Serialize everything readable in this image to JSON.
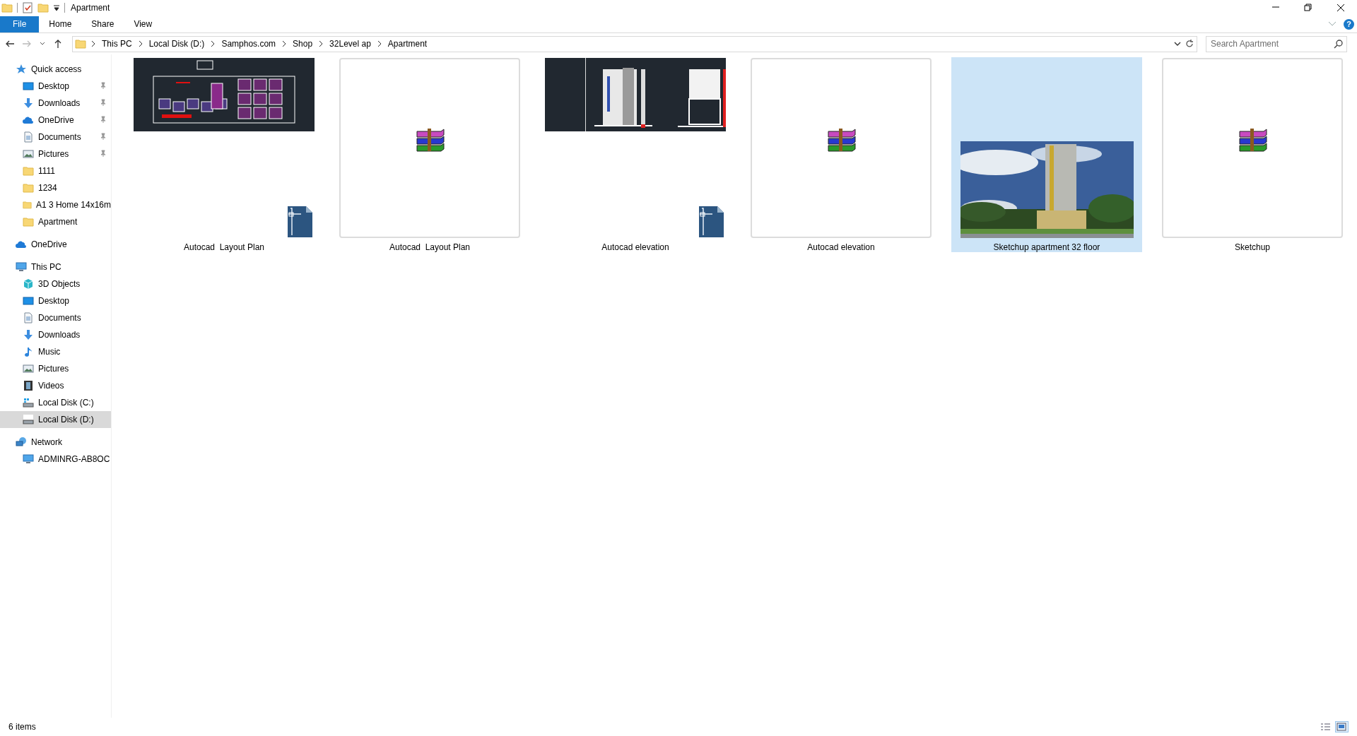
{
  "window": {
    "title": "Apartment"
  },
  "ribbon_tabs": [
    {
      "label": "File",
      "kind": "file"
    },
    {
      "label": "Home",
      "kind": "tab"
    },
    {
      "label": "Share",
      "kind": "tab"
    },
    {
      "label": "View",
      "kind": "tab"
    }
  ],
  "help": "?",
  "address_bar": {
    "path": [
      "This PC",
      "Local Disk (D:)",
      "Samphos.com",
      "Shop",
      "32Level ap",
      "Apartment"
    ]
  },
  "search": {
    "placeholder": "Search Apartment"
  },
  "sidebar": {
    "items": [
      {
        "label": "Quick access",
        "kind": "star",
        "selected": false,
        "children": [
          {
            "label": "Desktop",
            "kind": "desktop",
            "pinned": true,
            "selected": false
          },
          {
            "label": "Downloads",
            "kind": "download",
            "pinned": true,
            "selected": false
          },
          {
            "label": "OneDrive",
            "kind": "cloud",
            "pinned": true,
            "selected": false
          },
          {
            "label": "Documents",
            "kind": "document",
            "pinned": true,
            "selected": false
          },
          {
            "label": "Pictures",
            "kind": "pictures",
            "pinned": true,
            "selected": false
          },
          {
            "label": "1111",
            "kind": "folder",
            "pinned": false,
            "selected": false
          },
          {
            "label": "1234",
            "kind": "folder",
            "pinned": false,
            "selected": false
          },
          {
            "label": "A1 3 Home 14x16m",
            "kind": "folder",
            "pinned": false,
            "selected": false
          },
          {
            "label": "Apartment",
            "kind": "folder",
            "pinned": false,
            "selected": false
          }
        ]
      },
      {
        "label": "OneDrive",
        "kind": "cloud",
        "selected": false
      },
      {
        "label": "This PC",
        "kind": "pc",
        "selected": false,
        "children": [
          {
            "label": "3D Objects",
            "kind": "cube",
            "selected": false
          },
          {
            "label": "Desktop",
            "kind": "desktop",
            "selected": false
          },
          {
            "label": "Documents",
            "kind": "document",
            "selected": false
          },
          {
            "label": "Downloads",
            "kind": "download",
            "selected": false
          },
          {
            "label": "Music",
            "kind": "music",
            "selected": false
          },
          {
            "label": "Pictures",
            "kind": "pictures",
            "selected": false
          },
          {
            "label": "Videos",
            "kind": "video",
            "selected": false
          },
          {
            "label": "Local Disk (C:)",
            "kind": "systemdisk",
            "selected": false
          },
          {
            "label": "Local Disk (D:)",
            "kind": "disk",
            "selected": true
          }
        ]
      },
      {
        "label": "Network",
        "kind": "network",
        "selected": false,
        "children": [
          {
            "label": "ADMINRG-AB8OC",
            "kind": "pc",
            "selected": false
          }
        ]
      }
    ]
  },
  "files": [
    {
      "label": "Autocad  Layout Plan",
      "kind": "plan",
      "selected": false
    },
    {
      "label": "Autocad  Layout Plan",
      "kind": "archive",
      "selected": false
    },
    {
      "label": "Autocad elevation",
      "kind": "elevation",
      "selected": false
    },
    {
      "label": "Autocad elevation",
      "kind": "archive",
      "selected": false
    },
    {
      "label": "Sketchup apartment 32 floor",
      "selected": true
    },
    {
      "label": "Sketchup",
      "kind": "archive",
      "selected": false
    }
  ],
  "status_bar": {
    "count": "6 items",
    "view_buttons": [
      {
        "kind": "details",
        "selected": false
      },
      {
        "kind": "large_icons",
        "selected": true
      }
    ]
  }
}
